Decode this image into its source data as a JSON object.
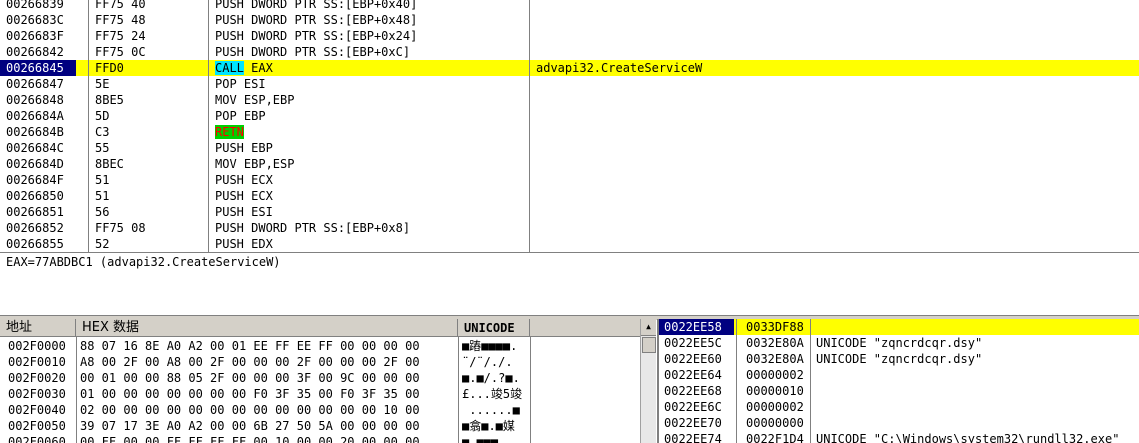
{
  "disassembly": {
    "rows": [
      {
        "addr": "00266839",
        "hex": "FF75 40",
        "mn": "PUSH",
        "ops": " DWORD PTR SS:[EBP+0x40]",
        "cmt": ""
      },
      {
        "addr": "0026683C",
        "hex": "FF75 48",
        "mn": "PUSH",
        "ops": " DWORD PTR SS:[EBP+0x48]",
        "cmt": ""
      },
      {
        "addr": "0026683F",
        "hex": "FF75 24",
        "mn": "PUSH",
        "ops": " DWORD PTR SS:[EBP+0x24]",
        "cmt": ""
      },
      {
        "addr": "00266842",
        "hex": "FF75 0C",
        "mn": "PUSH",
        "ops": " DWORD PTR SS:[EBP+0xC]",
        "cmt": ""
      },
      {
        "addr": "00266845",
        "hex": "FFD0",
        "mn": "CALL",
        "ops": " EAX",
        "cmt": "advapi32.CreateServiceW"
      },
      {
        "addr": "00266847",
        "hex": "5E",
        "mn": "POP",
        "ops": " ESI",
        "cmt": ""
      },
      {
        "addr": "00266848",
        "hex": "8BE5",
        "mn": "MOV",
        "ops": " ESP,EBP",
        "cmt": ""
      },
      {
        "addr": "0026684A",
        "hex": "5D",
        "mn": "POP",
        "ops": " EBP",
        "cmt": ""
      },
      {
        "addr": "0026684B",
        "hex": "C3",
        "mn": "RETN",
        "ops": "",
        "cmt": ""
      },
      {
        "addr": "0026684C",
        "hex": "55",
        "mn": "PUSH",
        "ops": " EBP",
        "cmt": ""
      },
      {
        "addr": "0026684D",
        "hex": "8BEC",
        "mn": "MOV",
        "ops": " EBP,ESP",
        "cmt": ""
      },
      {
        "addr": "0026684F",
        "hex": "51",
        "mn": "PUSH",
        "ops": " ECX",
        "cmt": ""
      },
      {
        "addr": "00266850",
        "hex": "51",
        "mn": "PUSH",
        "ops": " ECX",
        "cmt": ""
      },
      {
        "addr": "00266851",
        "hex": "56",
        "mn": "PUSH",
        "ops": " ESI",
        "cmt": ""
      },
      {
        "addr": "00266852",
        "hex": "FF75 08",
        "mn": "PUSH",
        "ops": " DWORD PTR SS:[EBP+0x8]",
        "cmt": ""
      },
      {
        "addr": "00266855",
        "hex": "52",
        "mn": "PUSH",
        "ops": " EDX",
        "cmt": ""
      }
    ]
  },
  "info": {
    "text": "EAX=77ABDBC1 (advapi32.CreateServiceW)"
  },
  "dump": {
    "headers": {
      "address": "地址",
      "hex": "HEX 数据",
      "unicode": "UNICODE"
    },
    "rows": [
      {
        "addr": "002F0000",
        "hex": "88 07 16 8E A0 A2 00 01 EE FF EE FF 00 00 00 00",
        "uni": "■蹖■■■■."
      },
      {
        "addr": "002F0010",
        "hex": "A8 00 2F 00 A8 00 2F 00 00 00 2F 00 00 00 2F 00",
        "uni": "¨/¨/./."
      },
      {
        "addr": "002F0020",
        "hex": "00 01 00 00 88 05 2F 00 00 00 3F 00 9C 00 00 00",
        "uni": "■.■/.?■."
      },
      {
        "addr": "002F0030",
        "hex": "01 00 00 00 00 00 00 00 F0 3F 35 00 F0 3F 35 00",
        "uni": "£...竣5竣"
      },
      {
        "addr": "002F0040",
        "hex": "02 00 00 00 00 00 00 00 00 00 00 00 00 00 10 00",
        "uni": " ......■"
      },
      {
        "addr": "002F0050",
        "hex": "39 07 17 3E A0 A2 00 00 6B 27 50 5A 00 00 00 00",
        "uni": "■翕■.■媒"
      },
      {
        "addr": "002F0060",
        "hex": "00 FF 00 00 FF FF FF FF 00 10 00 00 20 00 00 00",
        "uni": "■.■■■..."
      }
    ]
  },
  "stack": {
    "rows": [
      {
        "addr": "0022EE58",
        "val": "0033DF88",
        "cmt": ""
      },
      {
        "addr": "0022EE5C",
        "val": "0032E80A",
        "cmt": "UNICODE \"zqncrdcqr.dsy\""
      },
      {
        "addr": "0022EE60",
        "val": "0032E80A",
        "cmt": "UNICODE \"zqncrdcqr.dsy\""
      },
      {
        "addr": "0022EE64",
        "val": "00000002",
        "cmt": ""
      },
      {
        "addr": "0022EE68",
        "val": "00000010",
        "cmt": ""
      },
      {
        "addr": "0022EE6C",
        "val": "00000002",
        "cmt": ""
      },
      {
        "addr": "0022EE70",
        "val": "00000000",
        "cmt": ""
      },
      {
        "addr": "0022EE74",
        "val": "0022F1D4",
        "cmt": "UNICODE \"C:\\Windows\\system32\\rundll32.exe\""
      }
    ]
  },
  "colors": {
    "selection_bg": "#ffff00",
    "selection_addr_bg": "#000080",
    "call_highlight": "#00e5ff",
    "ret_highlight_bg": "#00d000",
    "ret_highlight_fg": "#ff0000"
  }
}
